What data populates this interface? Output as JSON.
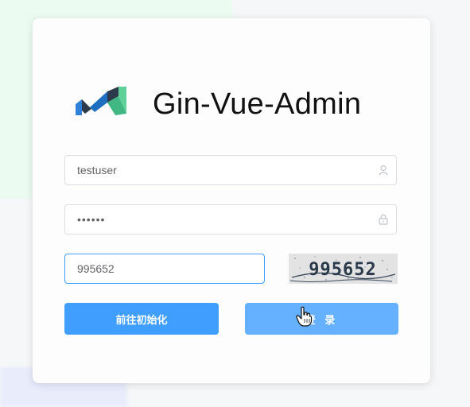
{
  "app": {
    "title": "Gin-Vue-Admin"
  },
  "form": {
    "username": {
      "value": "testuser"
    },
    "password": {
      "value": "••••••"
    },
    "captcha": {
      "value": "995652",
      "image_text": "995652"
    }
  },
  "buttons": {
    "init_label": "前往初始化",
    "login_label": "登 录"
  },
  "icons": {
    "logo": "gin-vue-admin-logo",
    "username_suffix": "user-icon",
    "password_suffix": "lock-icon",
    "pointer": "hand-cursor-icon"
  },
  "colors": {
    "primary": "#409eff",
    "primary_light": "#66b1ff",
    "logo_dark": "#2d3a4b",
    "logo_green": "#41b883",
    "logo_blue": "#2f7fd8"
  }
}
